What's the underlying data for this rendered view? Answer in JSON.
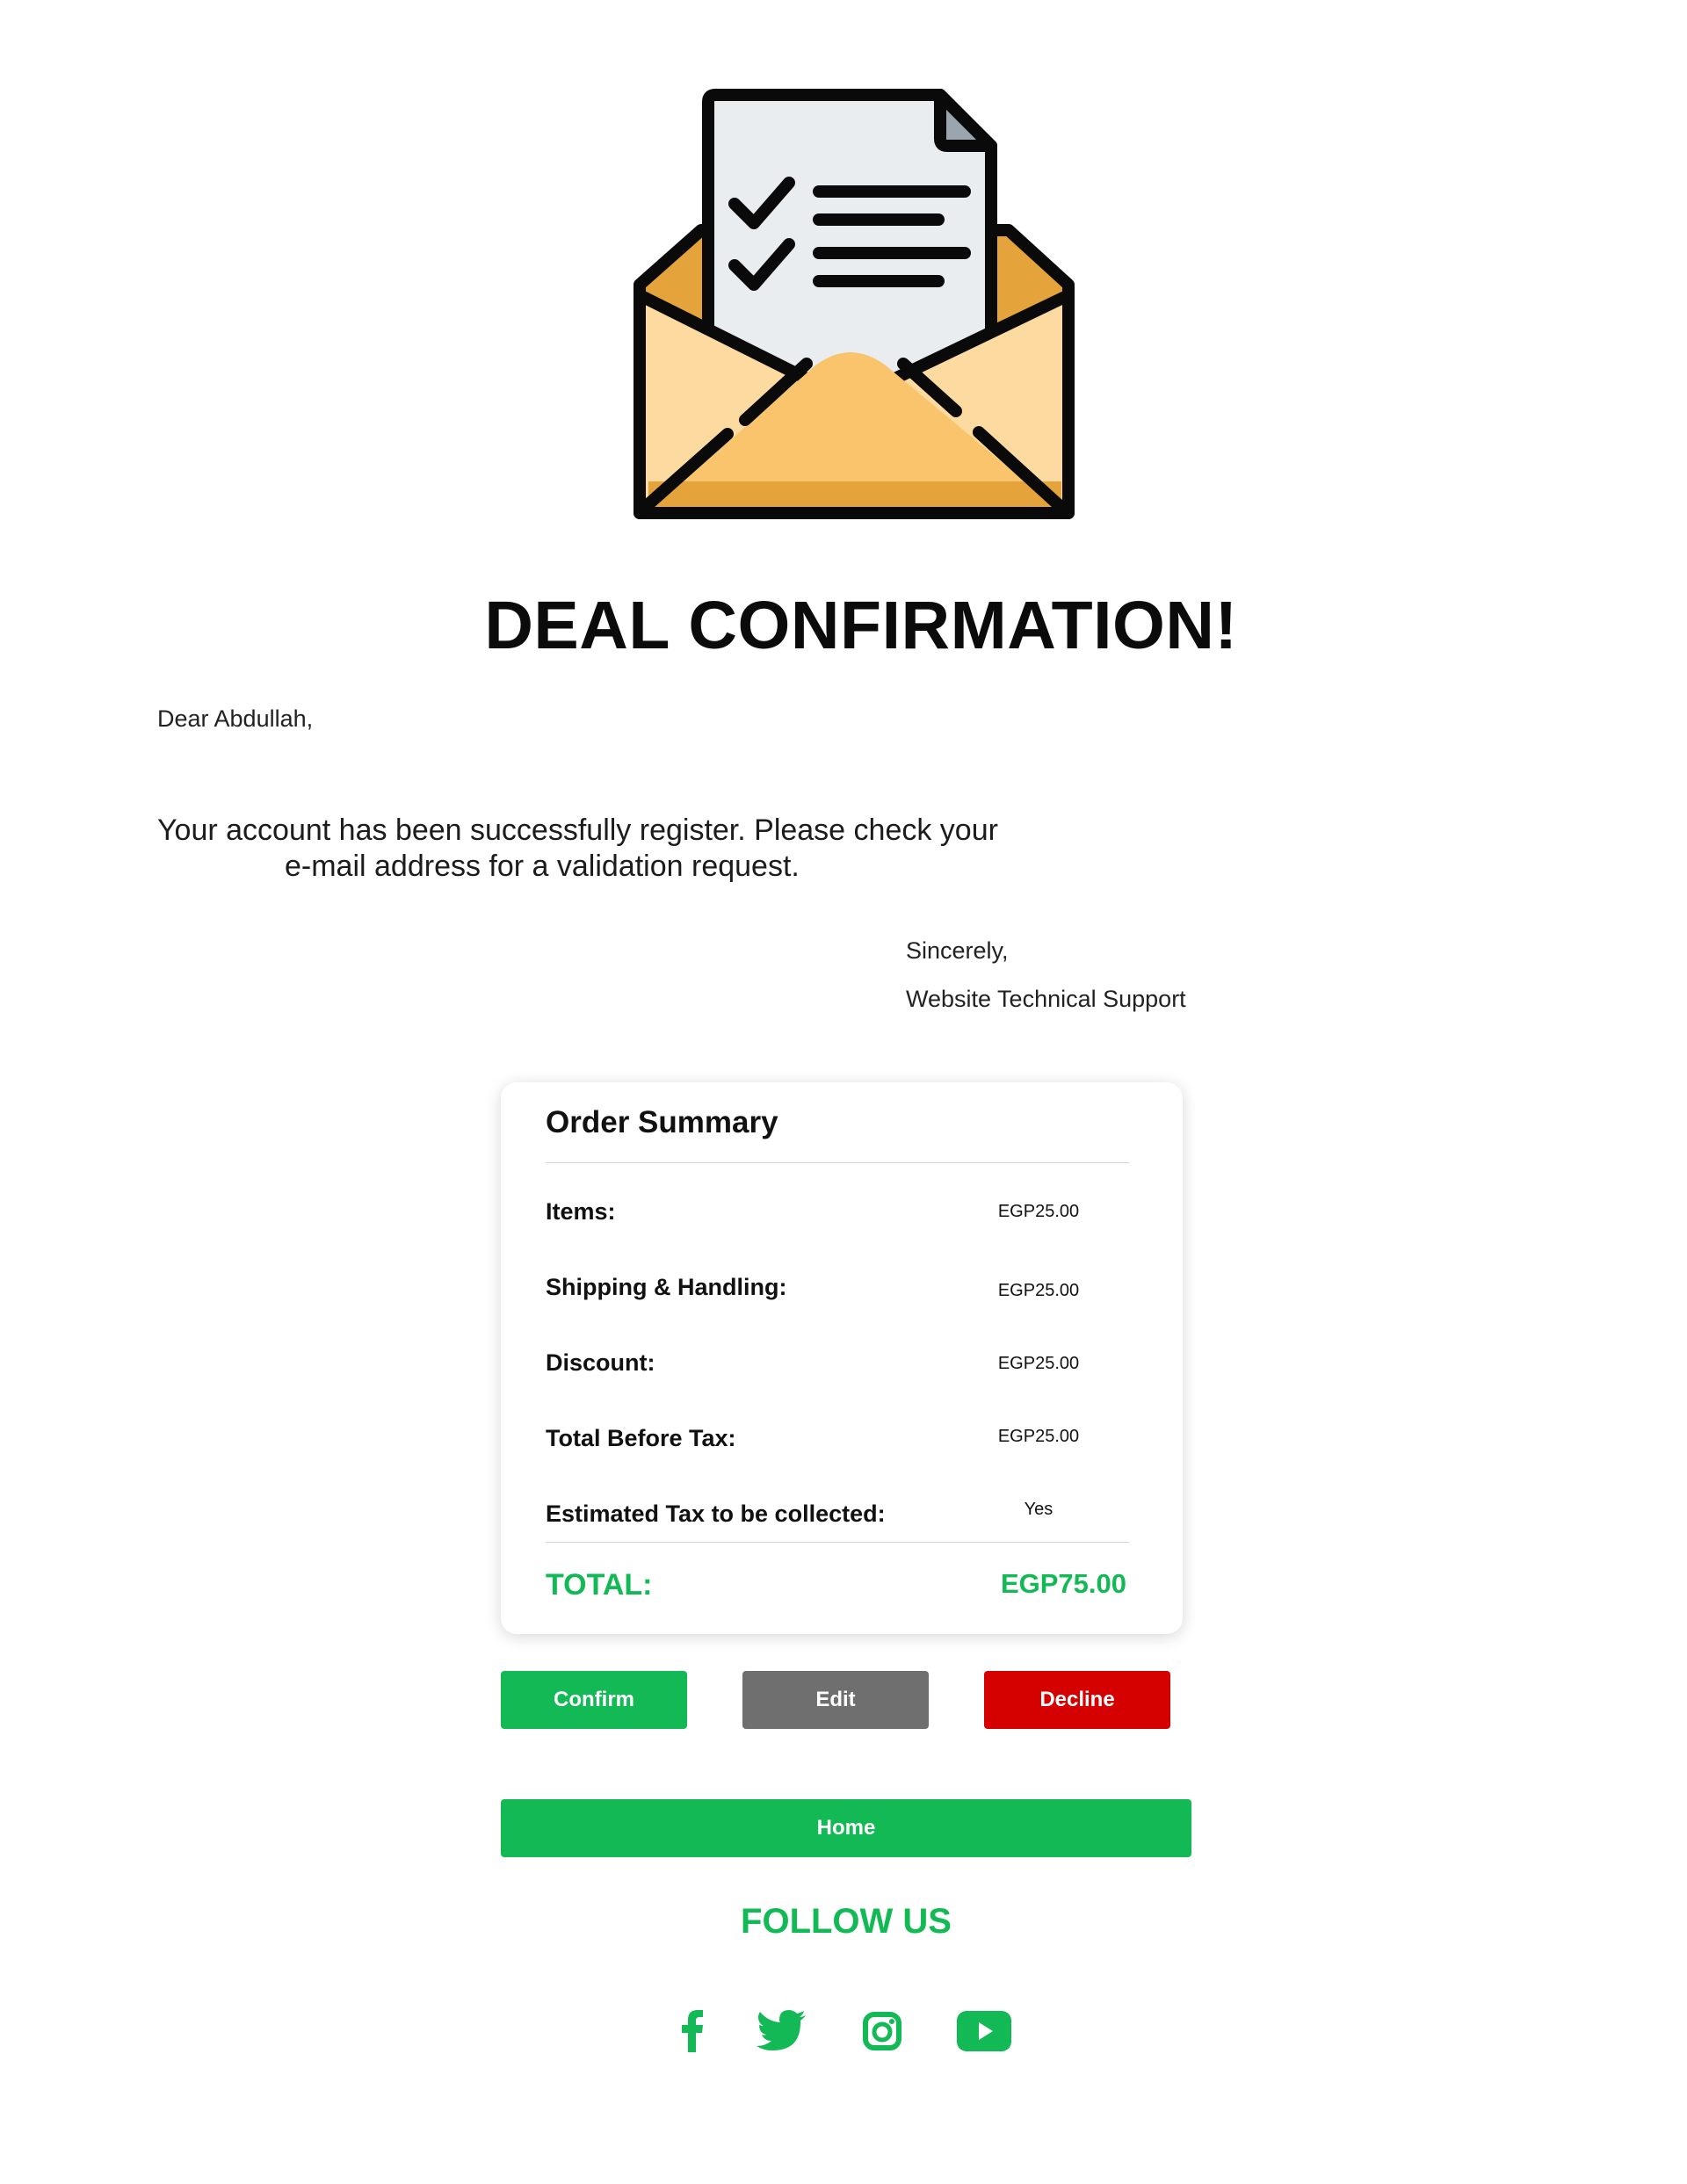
{
  "hero": {
    "icon": "envelope-checklist-icon"
  },
  "headline": "DEAL CONFIRMATION!",
  "greeting": "Dear Abdullah,",
  "message": {
    "line1": "Your account has been successfully register. Please check your",
    "line2": "e-mail address for a validation request."
  },
  "signature": {
    "closing": "Sincerely,",
    "sender": "Website Technical Support"
  },
  "order_summary": {
    "title": "Order Summary",
    "rows": [
      {
        "label": "Items:",
        "value": "EGP25.00"
      },
      {
        "label": "Shipping & Handling:",
        "value": "EGP25.00"
      },
      {
        "label": "Discount:",
        "value": "EGP25.00"
      },
      {
        "label": "Total Before Tax:",
        "value": "EGP25.00"
      },
      {
        "label": "Estimated Tax to be collected:",
        "value": "Yes"
      }
    ],
    "total_label": "TOTAL:",
    "total_value": "EGP75.00"
  },
  "buttons": {
    "confirm": "Confirm",
    "edit": "Edit",
    "decline": "Decline",
    "home": "Home"
  },
  "follow": {
    "title": "FOLLOW US",
    "icons": [
      "facebook-icon",
      "twitter-icon",
      "instagram-icon",
      "youtube-icon"
    ]
  },
  "colors": {
    "accent_green": "#12b955",
    "edit_grey": "#6f6f6f",
    "decline_red": "#d50000",
    "envelope_orange": "#f9c46c"
  }
}
